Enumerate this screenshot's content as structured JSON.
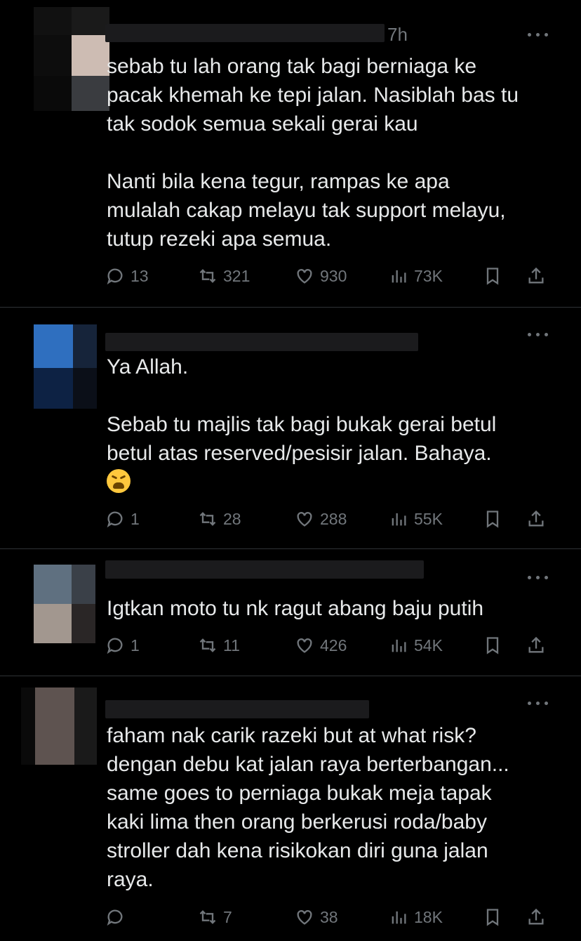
{
  "tweets": [
    {
      "time": "7h",
      "text": "sebab tu lah orang tak bagi berniaga ke\npacak khemah ke tepi jalan. Nasiblah bas tu\ntak sodok semua sekali gerai kau\n\nNanti bila kena tegur, rampas ke apa\nmulalah cakap melayu tak support melayu,\ntutup rezeki apa semua.",
      "replies": "13",
      "retweets": "321",
      "likes": "930",
      "views": "73K"
    },
    {
      "time": "",
      "text": "Ya Allah.\n\nSebab tu majlis tak bagi bukak gerai betul\nbetul atas reserved/pesisir jalan. Bahaya.",
      "emoji": "weary-face",
      "replies": "1",
      "retweets": "28",
      "likes": "288",
      "views": "55K"
    },
    {
      "time": "",
      "text": "Igtkan moto tu nk ragut abang baju putih",
      "replies": "1",
      "retweets": "11",
      "likes": "426",
      "views": "54K"
    },
    {
      "time": "",
      "text": "faham nak carik razeki but at what risk?\ndengan debu kat jalan raya berterbangan...\nsame goes to perniaga bukak meja tapak\nkaki lima then orang berkerusi roda/baby\nstroller dah kena risikokan diri guna jalan\nraya.",
      "replies": "",
      "retweets": "7",
      "likes": "38",
      "views": "18K"
    }
  ],
  "icons": {
    "reply": "speech-bubble-icon",
    "retweet": "retweet-arrows-icon",
    "like": "heart-icon",
    "views": "bar-chart-icon",
    "bookmark": "bookmark-icon",
    "share": "share-upload-icon",
    "more": "more-dots-icon"
  },
  "colors": {
    "background": "#000000",
    "text": "#e7e9ea",
    "muted": "#71767b",
    "divider": "#2f3336"
  }
}
